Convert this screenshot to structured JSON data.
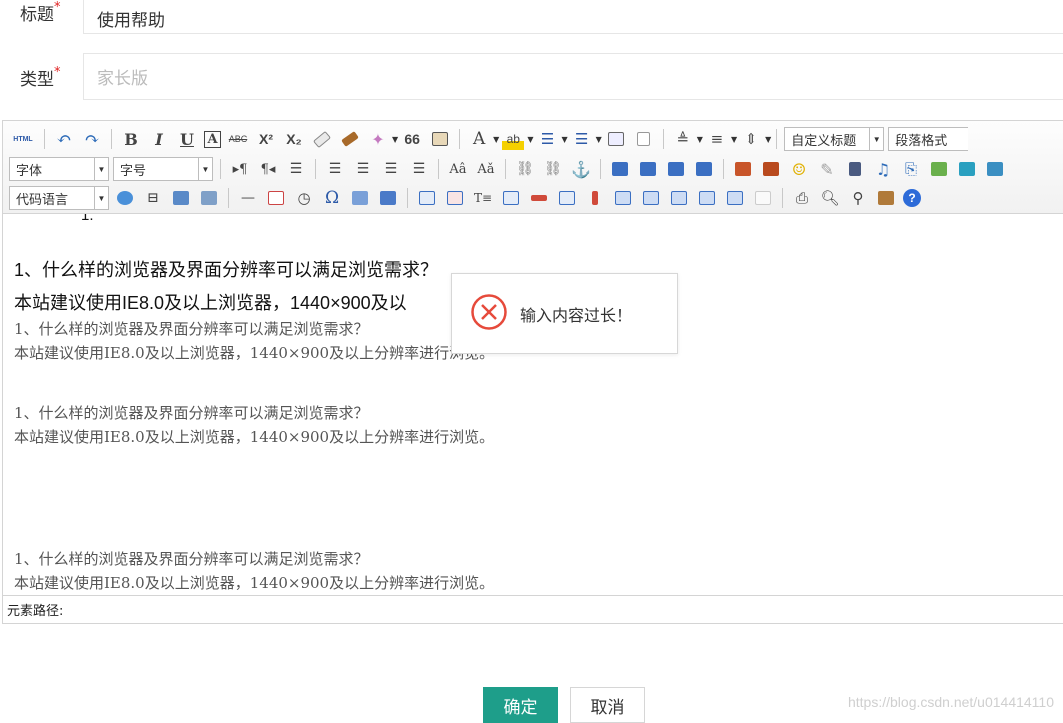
{
  "form": {
    "title_label": "标题",
    "title_value": "使用帮助",
    "type_label": "类型",
    "type_placeholder": "家长版",
    "required_mark": "*"
  },
  "toolbar": {
    "source_label": "HTML",
    "bold": "B",
    "italic": "I",
    "underline": "U",
    "border": "A",
    "strike": "ABC",
    "superscript": "X²",
    "subscript": "X₂",
    "quote": "66",
    "fontcolor": "A",
    "custom_title": "自定义标题",
    "paragraph": "段落格式",
    "font_family": "字体",
    "font_size": "字号",
    "code_language": "代码语言",
    "omega": "Ω",
    "help": "?"
  },
  "content": {
    "top_fragment": "1.",
    "q_sans": "1、什么样的浏览器及界面分辨率可以满足浏览需求？",
    "a_sans": "本站建议使用IE8.0及以上浏览器，1440×900及以",
    "q": "1、什么样的浏览器及界面分辨率可以满足浏览需求？",
    "a": "本站建议使用IE8.0及以上浏览器，1440×900及以上分辨率进行浏览。"
  },
  "statusbar": {
    "element_path": "元素路径:"
  },
  "toast": {
    "message": "输入内容过长！",
    "icon": "error-circle-icon"
  },
  "buttons": {
    "confirm": "确定",
    "cancel": "取消"
  },
  "watermark": "https://blog.csdn.net/u014414110",
  "colors": {
    "primary": "#1e9e8a",
    "error": "#e64a3b",
    "required": "#e02020"
  }
}
